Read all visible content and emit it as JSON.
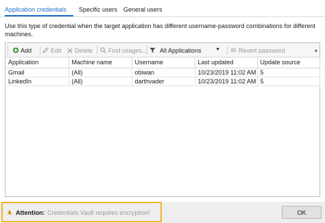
{
  "tabs": [
    {
      "label": "Application credentials",
      "active": true
    },
    {
      "label": "Specific users",
      "active": false
    },
    {
      "label": "General users",
      "active": false
    }
  ],
  "description": "Use this type of credential when the target application has different username-password combinations for different machines.",
  "toolbar": {
    "add_label": "Add",
    "edit_label": "Edit",
    "delete_label": "Delete",
    "find_usages_label": "Find usages...",
    "filter_selected": "All Applications",
    "revert_password_label": "Revert password"
  },
  "table": {
    "columns": [
      "Application",
      "Machine name",
      "Username",
      "Last updated",
      "Update source"
    ],
    "rows": [
      [
        "Gmail",
        "(All)",
        "obiwan",
        "10/23/2019 11:02 AM",
        "5"
      ],
      [
        "LinkedIn",
        "(All)",
        "darthvader",
        "10/23/2019 11:02 AM",
        "5"
      ]
    ]
  },
  "footer": {
    "attention_label": "Attention:",
    "attention_message": "Credentials Vault requires encryption!",
    "ok_label": "OK"
  },
  "colors": {
    "accent": "#1e6fd0",
    "attention_border": "#f0b429",
    "add_icon": "#2e8b2e"
  },
  "icons": {
    "add": "plus-circle-icon",
    "edit": "pencil-icon",
    "delete": "x-icon",
    "find": "magnifier-icon",
    "filter": "funnel-icon",
    "revert": "revert-icon",
    "warning": "warning-triangle-icon"
  }
}
